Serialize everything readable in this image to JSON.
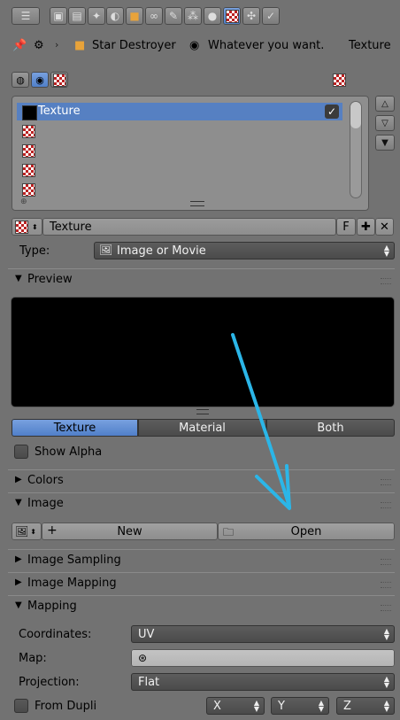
{
  "header": {
    "tabs": [
      "render",
      "render-layers",
      "scene",
      "world",
      "object",
      "constraints",
      "modifiers",
      "particles",
      "physics",
      "material",
      "texture",
      "other"
    ]
  },
  "breadcrumb": {
    "object": "Star Destroyer",
    "material": "Whatever you want.",
    "texture": "Texture"
  },
  "texture_slots": {
    "items": [
      "Texture",
      "",
      "",
      "",
      ""
    ]
  },
  "datablock": {
    "name": "Texture",
    "fake_user": "F"
  },
  "type_row": {
    "label": "Type:",
    "value": "Image or Movie"
  },
  "preview": {
    "title": "Preview",
    "modes": [
      "Texture",
      "Material",
      "Both"
    ],
    "active_mode": "Texture",
    "show_alpha": "Show Alpha"
  },
  "panels": {
    "colors": "Colors",
    "image": "Image",
    "image_sampling": "Image Sampling",
    "image_mapping": "Image Mapping",
    "mapping": "Mapping"
  },
  "image_panel": {
    "new_label": "New",
    "open_label": "Open"
  },
  "mapping": {
    "coordinates_label": "Coordinates:",
    "coordinates_value": "UV",
    "map_label": "Map:",
    "map_value": "",
    "projection_label": "Projection:",
    "projection_value": "Flat",
    "from_dupli": "From Dupli",
    "axes": [
      "X",
      "Y",
      "Z"
    ]
  },
  "colors": {
    "bg": "#727272",
    "accent": "#5680c2",
    "annotation_arrow": "#2bb6e8"
  }
}
